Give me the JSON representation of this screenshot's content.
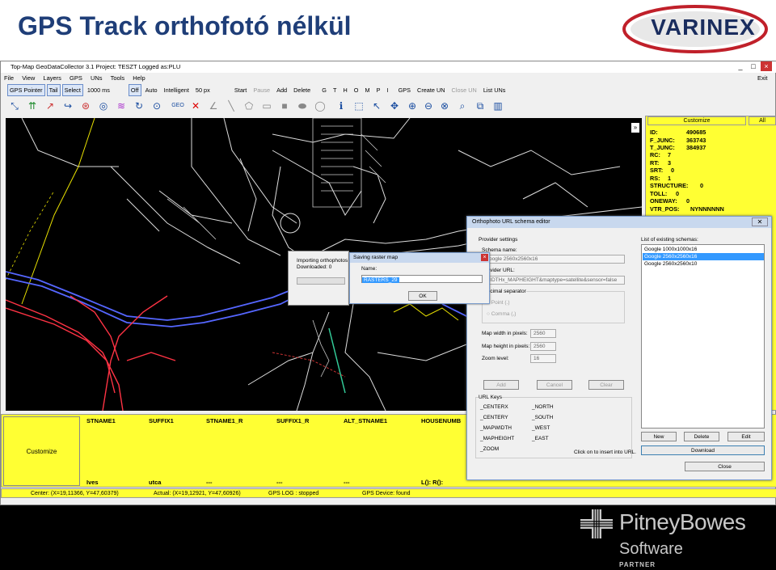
{
  "slide": {
    "title": "GPS Track orthofotó nélkül",
    "logo_text": "VARINEX"
  },
  "app": {
    "window_title": "Top-Map GeoDataCollector 3.1   Project: TESZT  Logged as:PLU",
    "menu": [
      "File",
      "View",
      "Layers",
      "GPS",
      "UNs",
      "Tools",
      "Help"
    ],
    "exit_label": "Exit",
    "toolbar": {
      "gps_pointer": "GPS Pointer",
      "tail": "Tail",
      "select": "Select",
      "interval": "1000 ms",
      "off": "Off",
      "auto": "Auto",
      "intelligent": "Intelligent",
      "px": "50 px",
      "start": "Start",
      "pause": "Pause",
      "add": "Add",
      "delete": "Delete",
      "letters": [
        "G",
        "T",
        "H",
        "O",
        "M",
        "P",
        "I"
      ],
      "gps": "GPS",
      "create_un": "Create UN",
      "close_un": "Close UN",
      "list_uns": "List UNs"
    },
    "attr_panel": {
      "customize": "Customize",
      "all": "All",
      "rows": [
        {
          "k": "ID:",
          "v": "490685"
        },
        {
          "k": "F_JUNC:",
          "v": "363743"
        },
        {
          "k": "T_JUNC:",
          "v": "384937"
        },
        {
          "k": "RC:",
          "v": "7"
        },
        {
          "k": "RT:",
          "v": "3"
        },
        {
          "k": "SRT:",
          "v": "0"
        },
        {
          "k": "RS:",
          "v": "1"
        },
        {
          "k": "STRUCTURE:",
          "v": "0"
        },
        {
          "k": "TOLL:",
          "v": "0"
        },
        {
          "k": "ONEWAY:",
          "v": "0"
        },
        {
          "k": "VTR_POS:",
          "v": "NYNNNNNN"
        }
      ]
    },
    "bottom": {
      "customize": "Customize",
      "columns": [
        "STNAME1",
        "SUFFIX1",
        "STNAME1_R",
        "SUFFIX1_R",
        "ALT_STNAME1",
        "HOUSENUMB"
      ],
      "values": [
        "Ives",
        "utca",
        "---",
        "---",
        "---",
        "L():  R():"
      ]
    },
    "status": {
      "center": "Center: (X=19,11366, Y=47,60379)",
      "actual": "Actual: (X=19,12921, Y=47,60926)",
      "gps_log": "GPS LOG : stopped",
      "gps_device": "GPS Device: found"
    },
    "ortho_dialog": {
      "title": "Orthophoto URL schema editor",
      "provider_settings": "Provider settings",
      "schema_name_label": "Schema name:",
      "schema_name": "Google 2560x2560x16",
      "provider_url_label": "Provider URL:",
      "provider_url": "WIDTHx_MAPHEIGHT&maptype=satellite&sensor=false",
      "decimal_separator": "Decimal separator",
      "point": "Point (.)",
      "comma": "Comma (,)",
      "map_width_label": "Map width in pixels:",
      "map_width": "2560",
      "map_height_label": "Map height in pixels:",
      "map_height": "2560",
      "zoom_label": "Zoom level:",
      "zoom": "16",
      "add": "Add",
      "cancel": "Cancel",
      "clear": "Clear",
      "url_keys": "URL Keys",
      "keys": [
        "_CENTERX",
        "_CENTERY",
        "_MAPWIDTH",
        "_MAPHEIGHT",
        "_ZOOM"
      ],
      "keys2": [
        "_NORTH",
        "_SOUTH",
        "_WEST",
        "_EAST"
      ],
      "click_hint": "Click on to insert into URL.",
      "list_label": "List of existing schemas:",
      "schemas": [
        "Google 1000x1000x16",
        "Google 2560x2560x16",
        "Google 2560x2560x10"
      ],
      "selected_schema": "Google 2560x2560x16",
      "new": "New",
      "delete": "Delete",
      "edit": "Edit",
      "download": "Download",
      "close": "Close"
    },
    "import_dialog": {
      "line1": "Importing orthophotos",
      "line2": "Downloaded: 0"
    },
    "raster_dialog": {
      "title": "Saving raster map",
      "name_label": "Name:",
      "name_value": "RASTERS_29",
      "ok": "OK"
    }
  },
  "footer": {
    "brand": "PitneyBowes",
    "sub": "Software",
    "partner": "PARTNER"
  },
  "colors": {
    "title_blue": "#1f3e78",
    "panel_yellow": "#ffff33",
    "track_blue": "#5566ff",
    "route_red": "#ff3344"
  }
}
